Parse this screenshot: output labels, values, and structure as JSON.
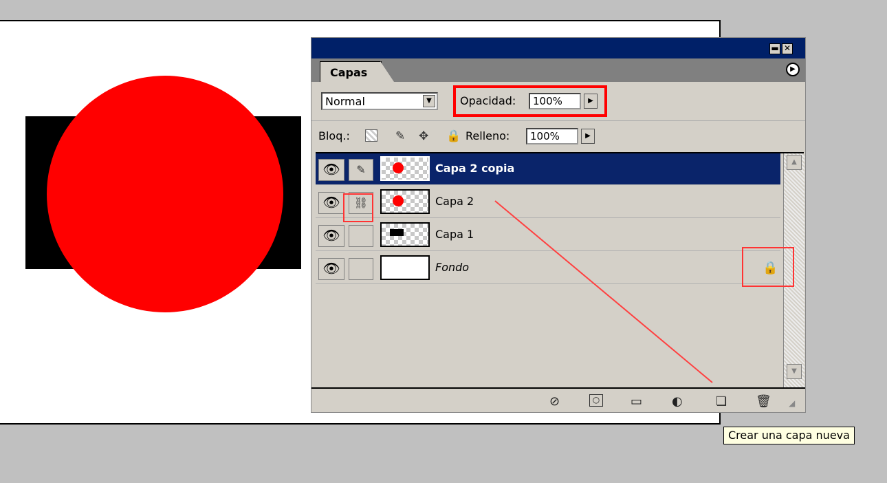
{
  "window": {
    "minimize_glyph": "▬",
    "close_glyph": "✕"
  },
  "panel": {
    "tab_label": "Capas",
    "menu_glyph": "▶"
  },
  "blend": {
    "mode": "Normal",
    "arrow": "▼"
  },
  "opacity": {
    "label": "Opacidad:",
    "value": "100%",
    "arrow": "▶"
  },
  "lock": {
    "label": "Bloq.:",
    "icons": [
      "checker-lock-icon",
      "brush-lock-icon",
      "move-lock-icon",
      "padlock-icon"
    ]
  },
  "fill": {
    "label": "Relleno:",
    "value": "100%",
    "arrow": "▶"
  },
  "layers": [
    {
      "name": "Capa 2 copia",
      "selected": true,
      "thumb": "red-dot",
      "link": "brush-icon"
    },
    {
      "name": "Capa 2",
      "selected": false,
      "thumb": "red-dot",
      "link": "chain-link-icon"
    },
    {
      "name": "Capa 1",
      "selected": false,
      "thumb": "black-bar",
      "link": ""
    },
    {
      "name": "Fondo",
      "selected": false,
      "thumb": "white",
      "link": "",
      "locked": true
    }
  ],
  "bottom_icons": [
    "layer-style-icon",
    "layer-mask-icon",
    "new-group-icon",
    "adjustment-layer-icon",
    "new-layer-icon",
    "trash-icon"
  ],
  "tooltip": "Crear una capa nueva",
  "colors": {
    "accent": "#0a246a",
    "highlight": "#ff0000",
    "panel_bg": "#d4d0c8"
  }
}
